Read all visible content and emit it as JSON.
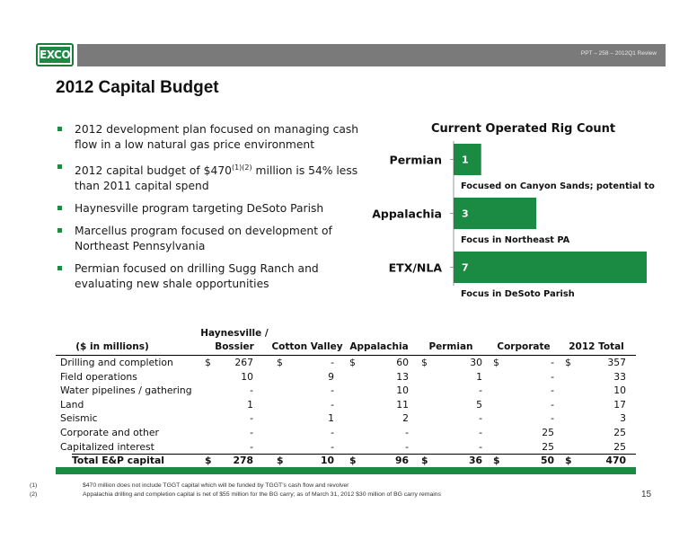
{
  "logo_text": "EXCO",
  "header_text": "PPT – 258 – 2012Q1 Review",
  "page_title": "2012 Capital Budget",
  "bullets": [
    "2012 development plan focused on managing cash flow in a low natural gas price environment",
    {
      "pre": "2012 capital budget of $470",
      "sup": "(1)(2)",
      "post": " million is 54% less than 2011 capital spend"
    },
    "Haynesville program targeting DeSoto Parish",
    "Marcellus program focused on development of Northeast Pennsylvania",
    "Permian focused on drilling Sugg Ranch and evaluating new shale opportunities"
  ],
  "colors": {
    "brand_green": "#1b8a43",
    "header_gray": "#7a7a7a"
  },
  "chart_data": {
    "type": "bar",
    "orientation": "horizontal",
    "title": "Current Operated Rig Count",
    "categories": [
      "Permian",
      "Appalachia",
      "ETX/NLA"
    ],
    "values": [
      1,
      3,
      7
    ],
    "annotations": [
      "Focused on Canyon Sands; potential to add",
      "Focus in Northeast PA",
      "Focus in DeSoto Parish"
    ],
    "xlim": [
      0,
      7
    ],
    "color": "#1b8a43",
    "grid": false
  },
  "table": {
    "unit_label": "($ in millions)",
    "columns": [
      "Haynesville / Bossier",
      "Cotton Valley",
      "Appalachia",
      "Permian",
      "Corporate",
      "2012 Total"
    ],
    "col_line1": [
      "Haynesville /",
      "",
      "",
      "",
      "",
      ""
    ],
    "col_line2": [
      "Bossier",
      "Cotton Valley",
      "Appalachia",
      "Permian",
      "Corporate",
      "2012 Total"
    ],
    "rows": [
      {
        "label": "Drilling and completion",
        "values": [
          "267",
          "-",
          "60",
          "30",
          "-",
          "357"
        ],
        "dollar": true
      },
      {
        "label": "Field operations",
        "values": [
          "10",
          "9",
          "13",
          "1",
          "-",
          "33"
        ]
      },
      {
        "label": "Water pipelines / gathering",
        "values": [
          "-",
          "-",
          "10",
          "-",
          "-",
          "10"
        ]
      },
      {
        "label": "Land",
        "values": [
          "1",
          "-",
          "11",
          "5",
          "-",
          "17"
        ]
      },
      {
        "label": "Seismic",
        "values": [
          "-",
          "1",
          "2",
          "-",
          "-",
          "3"
        ]
      },
      {
        "label": "Corporate and other",
        "values": [
          "-",
          "-",
          "-",
          "-",
          "25",
          "25"
        ]
      },
      {
        "label": "Capitalized interest",
        "values": [
          "-",
          "-",
          "-",
          "-",
          "25",
          "25"
        ]
      }
    ],
    "total": {
      "label": "Total E&P capital",
      "values": [
        "278",
        "10",
        "96",
        "36",
        "50",
        "470"
      ]
    },
    "dollar_sign": "$"
  },
  "footnotes": [
    {
      "num": "(1)",
      "text": "$470 million does not include TGGT capital which will be funded by TGGT’s cash flow and revolver"
    },
    {
      "num": "(2)",
      "text": "Appalachia drilling and completion capital is net of $55 million for the BG carry; as of March 31, 2012 $30 million of BG carry remains"
    }
  ],
  "page_number": "15"
}
